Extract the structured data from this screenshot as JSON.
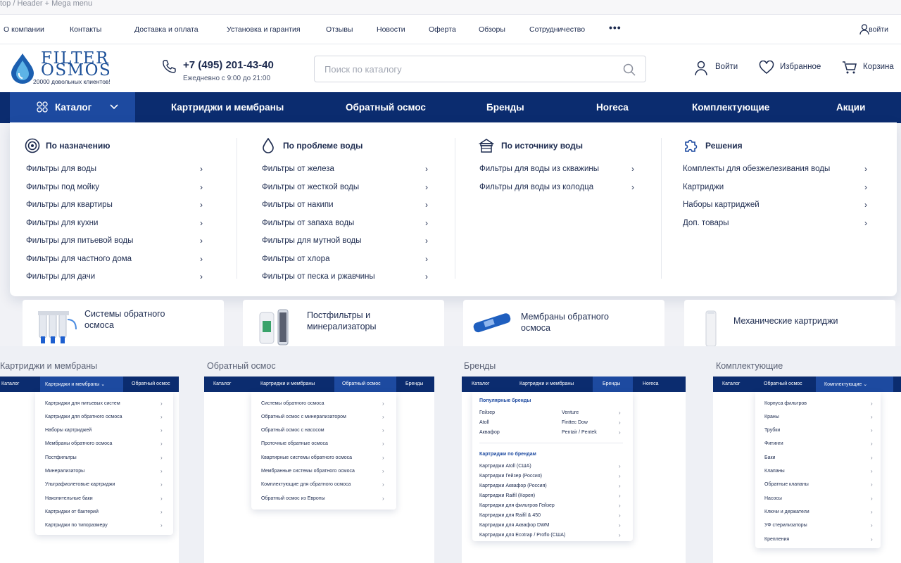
{
  "breadcrumb": "top / Header + Mega menu",
  "topnav": {
    "items": [
      "О компании",
      "Контакты",
      "Доставка и оплата",
      "Установка и гарантия",
      "Отзывы",
      "Новости",
      "Оферта",
      "Обзоры",
      "Сотрудничество"
    ],
    "more": "•••",
    "login": "войти"
  },
  "header": {
    "logo_line1": "FILTER",
    "logo_line2": "OSMOS",
    "logo_sub": "20000 довольных клиентов!",
    "phone": "+7 (495) 201-43-40",
    "hours": "Ежедневно с 9:00 до 21:00",
    "search_placeholder": "Поиск по каталогу",
    "login": "Войти",
    "favorites": "Избранное",
    "cart": "Корзина"
  },
  "catbar": {
    "catalog": "Каталог",
    "items": [
      "Картриджи и мембраны",
      "Обратный осмос",
      "Бренды",
      "Horeca",
      "Комплектующие",
      "Акции"
    ]
  },
  "mega": {
    "columns": [
      {
        "title": "По назначению",
        "icon": "target-icon",
        "items": [
          "Фильтры для воды",
          "Фильтры под мойку",
          "Фильтры для квартиры",
          "Фильтры для кухни",
          "Фильтры для питьевой воды",
          "Фильтры для частного дома",
          "Фильтры для дачи"
        ]
      },
      {
        "title": "По проблеме воды",
        "icon": "water-drop-icon",
        "items": [
          "Фильтры от железа",
          "Фильтры от жесткой воды",
          "Фильтры от накипи",
          "Фильтры от запаха воды",
          "Фильтры для мутной воды",
          "Фильтры от хлора",
          "Фильтры от песка и ржавчины"
        ]
      },
      {
        "title": "По источнику воды",
        "icon": "well-icon",
        "items": [
          "Фильтры для воды из скважины",
          "Фильтры для воды из колодца"
        ]
      },
      {
        "title": "Решения",
        "icon": "puzzle-icon",
        "items": [
          "Комплекты для обезжелезивания воды",
          "Картриджи",
          "Наборы картриджей",
          "Доп. товары"
        ]
      }
    ]
  },
  "tiles": [
    {
      "label": "Системы обратного осмоса",
      "icon": "ro-system-icon"
    },
    {
      "label": "Постфильтры и минерализаторы",
      "icon": "postfilter-icon"
    },
    {
      "label": "Мембраны обратного осмоса",
      "icon": "membrane-icon"
    },
    {
      "label": "Механические картриджи",
      "icon": "cartridge-icon"
    }
  ],
  "previews": [
    {
      "title": "Картриджи и мембраны",
      "nav": [
        "Каталог",
        "Картриджи и мембраны ⌄",
        "Обратный осмос"
      ],
      "items": [
        "Картриджи для питьевых систем",
        "Картриджи для обратного осмоса",
        "Наборы картриджей",
        "Мембраны обратного осмоса",
        "Постфильтры",
        "Минерализаторы",
        "Ультрафиолетовые картриджи",
        "Накопительные баки",
        "Картриджи от бактерий",
        "Картриджи по типоразмеру"
      ]
    },
    {
      "title": "Обратный осмос",
      "nav": [
        "Каталог",
        "Картриджи и мембраны",
        "Обратный осмос",
        "Бренды"
      ],
      "items": [
        "Системы обратного осмоса",
        "Обратный осмос с минерализатором",
        "Обратный осмос с насосом",
        "Проточные обратные осмоса",
        "Квартирные системы обратного осмоса",
        "Мембранные системы обратного осмоса",
        "Комплектующие для обратного осмоса",
        "Обратный осмос из Европы"
      ]
    },
    {
      "title": "Бренды",
      "nav": [
        "Каталог",
        "Картриджи и мембраны",
        "Бренды",
        "Horeca"
      ],
      "popular_title": "Популярные бренды",
      "brands_left": [
        "Гейзер",
        "Atoll",
        "Аквафор"
      ],
      "brands_right": [
        "Venture",
        "Finttec Dow",
        "Pentair / Pentek"
      ],
      "by_brand_title": "Картриджи по брендам",
      "items": [
        "Картриджи Atoll (США)",
        "Картриджи Гейзер (Россия)",
        "Картриджи Аквафор (Россия)",
        "Картриджи Raifil (Корея)",
        "Картриджи для фильтров Гейзер",
        "Картриджи для Raifil & 450",
        "Картриджи для Аквафор DWM",
        "Картриджи для Ecotrap / Proflo (США)"
      ]
    },
    {
      "title": "Комплектующие",
      "nav": [
        "Каталог",
        "Обратный осмос",
        "Комплектующие ⌄"
      ],
      "items": [
        "Корпуса фильтров",
        "Краны",
        "Трубки",
        "Фитинги",
        "Баки",
        "Клапаны",
        "Обратные клапаны",
        "Насосы",
        "Ключи и держатели",
        "УФ стерилизаторы",
        "Крепления"
      ]
    }
  ],
  "colors": {
    "navy": "#0b2c6f",
    "active_blue": "#1d4aa0",
    "text": "#1d2b4f"
  }
}
